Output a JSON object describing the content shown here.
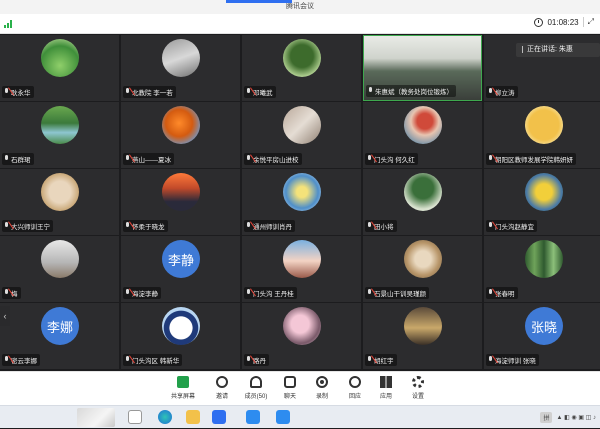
{
  "window": {
    "title": "腾讯会议"
  },
  "infobar": {
    "duration": "01:08:23",
    "expand_label": "⤢"
  },
  "speaking": {
    "label": "正在讲话:",
    "name": "朱惠"
  },
  "participants": [
    {
      "name": "耿永华",
      "mic": "muted",
      "avatar": "field"
    },
    {
      "name": "北教院 李一若",
      "mic": "muted",
      "avatar": "figure"
    },
    {
      "name": "邓曦武",
      "mic": "muted",
      "avatar": "tree"
    },
    {
      "name": "朱惠斌（教务处岗位锻炼）",
      "mic": "on",
      "avatar": "video"
    },
    {
      "name": "柳立涛",
      "mic": "muted",
      "avatar": "blank"
    },
    {
      "name": "石群珺",
      "mic": "on",
      "avatar": "lake"
    },
    {
      "name": "燕山——夏冰",
      "mic": "muted",
      "avatar": "autumn"
    },
    {
      "name": "余悦平房山进校",
      "mic": "muted",
      "avatar": "object"
    },
    {
      "name": "门头沟 何久红",
      "mic": "muted",
      "avatar": "person"
    },
    {
      "name": "朝阳区教师发展学院韩妍妍",
      "mic": "muted",
      "avatar": "cartoon"
    },
    {
      "name": "大兴师训王宁",
      "mic": "muted",
      "avatar": "food"
    },
    {
      "name": "怀柔于晓龙",
      "mic": "muted",
      "avatar": "sunset"
    },
    {
      "name": "通州师训肖丹",
      "mic": "muted",
      "avatar": "flower"
    },
    {
      "name": "田小将",
      "mic": "muted",
      "avatar": "tree2"
    },
    {
      "name": "门头沟赵静宜",
      "mic": "muted",
      "avatar": "yellowflower"
    },
    {
      "name": "梅",
      "mic": "muted",
      "avatar": "child"
    },
    {
      "name": "海淀李静",
      "mic": "muted",
      "avatar": "text",
      "avatar_text": "李静"
    },
    {
      "name": "门头沟 王丹桂",
      "mic": "muted",
      "avatar": "sky"
    },
    {
      "name": "石景山干训吴瑾颜",
      "mic": "muted",
      "avatar": "beads"
    },
    {
      "name": "张春明",
      "mic": "muted",
      "avatar": "bamboo"
    },
    {
      "name": "密云李娜",
      "mic": "muted",
      "avatar": "text",
      "avatar_text": "李娜"
    },
    {
      "name": "门头沟区 韩新华",
      "mic": "muted",
      "avatar": "panda"
    },
    {
      "name": "路丹",
      "mic": "muted",
      "avatar": "blossom"
    },
    {
      "name": "胡红宇",
      "mic": "muted",
      "avatar": "room"
    },
    {
      "name": "海淀师训 张晓",
      "mic": "muted",
      "avatar": "text",
      "avatar_text": "张晓"
    }
  ],
  "toolbar": [
    {
      "label": "共享屏幕",
      "icon": "share-screen-icon",
      "color": "#22a04b"
    },
    {
      "label": "邀请",
      "icon": "invite-icon",
      "color": "#333333"
    },
    {
      "label": "成员(50)",
      "icon": "members-icon",
      "color": "#333333"
    },
    {
      "label": "聊天",
      "icon": "chat-icon",
      "color": "#333333"
    },
    {
      "label": "录制",
      "icon": "record-icon",
      "color": "#333333"
    },
    {
      "label": "回应",
      "icon": "reaction-icon",
      "color": "#333333"
    },
    {
      "label": "应用",
      "icon": "apps-icon",
      "color": "#333333"
    },
    {
      "label": "设置",
      "icon": "settings-icon",
      "color": "#333333"
    }
  ],
  "taskbar": {
    "lang": "拼",
    "time": ""
  },
  "colors": {
    "accent": "#2f6ff0",
    "green": "#22a04b",
    "muted": "#e5463a"
  }
}
